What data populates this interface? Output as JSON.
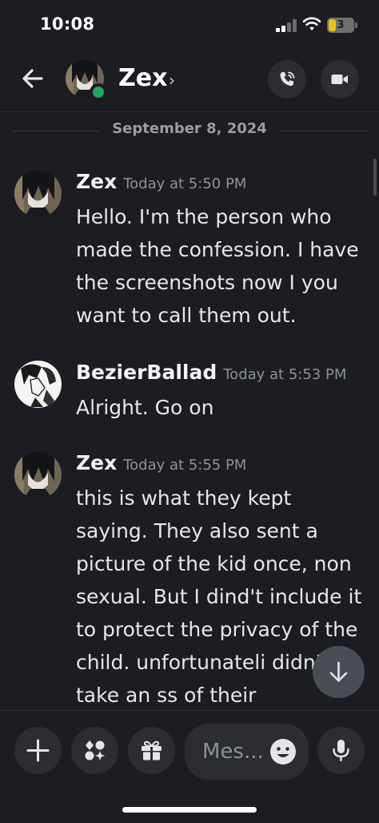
{
  "status_bar": {
    "time": "10:08",
    "battery": "3",
    "battery_level": 0.3
  },
  "header": {
    "contact_name": "Zex",
    "chevron": "›",
    "icons": [
      "back-arrow-icon",
      "phone-call-icon",
      "video-camera-icon"
    ]
  },
  "date_divider": "September 8, 2024",
  "messages": [
    {
      "author": "Zex",
      "time": "Today at 5:50 PM",
      "text": "Hello. I'm the person who made the confession. I have the screenshots now I you want to call them out."
    },
    {
      "author": "BezierBallad",
      "time": "Today at 5:53 PM",
      "text": "Alright. Go on"
    },
    {
      "author": "Zex",
      "time": "Today at 5:55 PM",
      "text": "this is what they kept saying. They also sent a picture of the kid once, non sexual. But I dind't include it to protect the privacy of the child. unfortunateli didn't take an ss of their"
    }
  ],
  "composer": {
    "placeholder": "Mes...",
    "icons": [
      "plus-icon",
      "apps-icon",
      "gift-icon",
      "emoji-icon",
      "microphone-icon"
    ]
  },
  "colors": {
    "background": "#1c1d22",
    "button": "#2b2d33",
    "online": "#23a55a",
    "battery": "#e8c21a"
  }
}
